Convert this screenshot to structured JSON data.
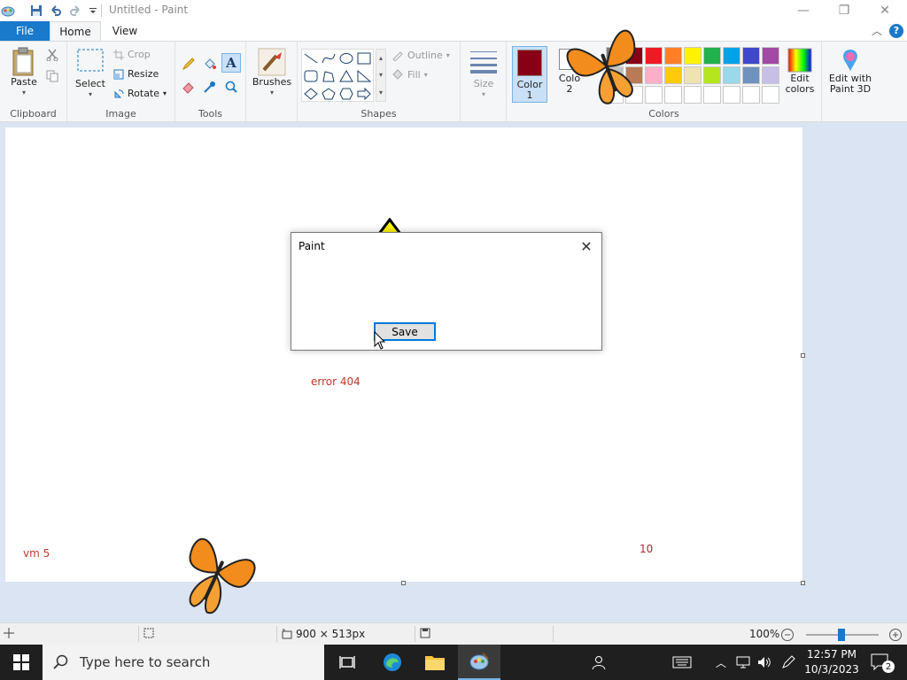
{
  "window": {
    "title": "Untitled - Paint",
    "minimize": "—",
    "maximize": "❐",
    "close": "✕"
  },
  "tabs": {
    "file": "File",
    "home": "Home",
    "view": "View"
  },
  "ribbon": {
    "clipboard": {
      "paste": "Paste",
      "label": "Clipboard"
    },
    "image": {
      "select": "Select",
      "crop": "Crop",
      "resize": "Resize",
      "rotate": "Rotate",
      "label": "Image"
    },
    "tools": {
      "label": "Tools"
    },
    "brushes": {
      "label": "Brushes"
    },
    "shapes": {
      "outline": "Outline",
      "fill": "Fill",
      "label": "Shapes"
    },
    "size": {
      "label": "Size"
    },
    "colors": {
      "color1": "Color\n1",
      "color1_line1": "Color",
      "color1_line2": "1",
      "color2_line1": "Colo",
      "color2_line2": "2",
      "color1_value": "#880015",
      "label": "Colors",
      "edit_colors_line1": "Edit",
      "edit_colors_line2": "colors",
      "paint3d_line1": "Edit with",
      "paint3d_line2": "Paint 3D",
      "palette": [
        "#7f7f7f",
        "#880015",
        "#ed1c24",
        "#ff7f27",
        "#fff200",
        "#22b14c",
        "#00a2e8",
        "#3f48cc",
        "#a349a4",
        "#c3c3c3",
        "#b97a57",
        "#ffaec9",
        "#ffc90e",
        "#efe4b0",
        "#b5e61d",
        "#99d9ea",
        "#7092be",
        "#c8bfe7",
        "#ffffff",
        "#ffffff",
        "#ffffff",
        "#ffffff",
        "#ffffff",
        "#ffffff",
        "#ffffff",
        "#ffffff",
        "#ffffff"
      ]
    }
  },
  "canvas": {
    "text_error": "error 404",
    "text_vm": "vm 5",
    "text_10": "10"
  },
  "dialog": {
    "title": "Paint",
    "save": "Save"
  },
  "status": {
    "dimensions": "900 × 513px",
    "zoom": "100%"
  },
  "taskbar": {
    "search_placeholder": "Type here to search",
    "time": "12:57 PM",
    "date": "10/3/2023",
    "notifications": "2"
  }
}
